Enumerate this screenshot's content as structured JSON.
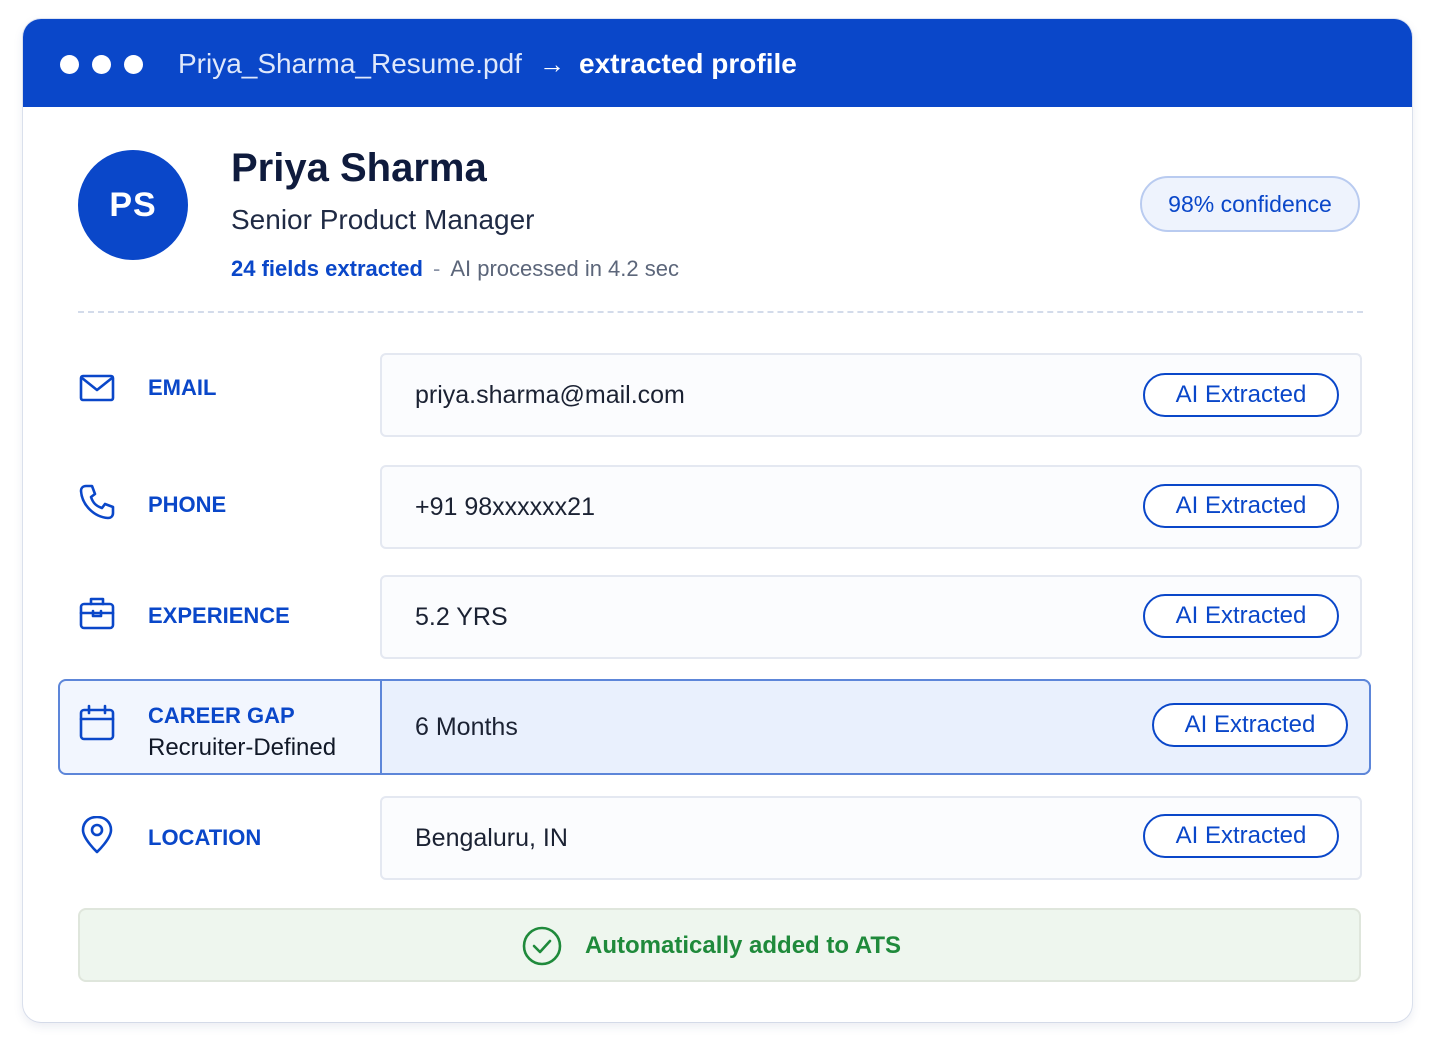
{
  "titlebar": {
    "filename": "Priya_Sharma_Resume.pdf",
    "arrow": "→",
    "mode": "extracted profile"
  },
  "profile": {
    "initials": "PS",
    "name": "Priya Sharma",
    "role": "Senior Product Manager",
    "fields_extracted": "24 fields extracted",
    "separator": "-",
    "processed": "AI processed in 4.2 sec",
    "confidence": "98% confidence"
  },
  "rows": [
    {
      "icon": "mail-icon",
      "label": "EMAIL",
      "value": "priya.sharma@mail.com",
      "badge": "AI Extracted"
    },
    {
      "icon": "phone-icon",
      "label": "PHONE",
      "value": "+91 98xxxxxx21",
      "badge": "AI Extracted"
    },
    {
      "icon": "briefcase-icon",
      "label": "EXPERIENCE",
      "value": "5.2 YRS",
      "badge": "AI Extracted"
    },
    {
      "icon": "calendar-icon",
      "label": "CAREER GAP",
      "sublabel": "Recruiter-Defined",
      "value": "6 Months",
      "badge": "AI Extracted"
    },
    {
      "icon": "location-pin-icon",
      "label": "LOCATION",
      "value": "Bengaluru, IN",
      "badge": "AI Extracted"
    }
  ],
  "ats": {
    "icon": "check-circle-icon",
    "message": "Automatically added to ATS"
  },
  "colors": {
    "primary": "#0a47c9",
    "success": "#1f8a3b",
    "success_bg": "#eef6ee"
  }
}
